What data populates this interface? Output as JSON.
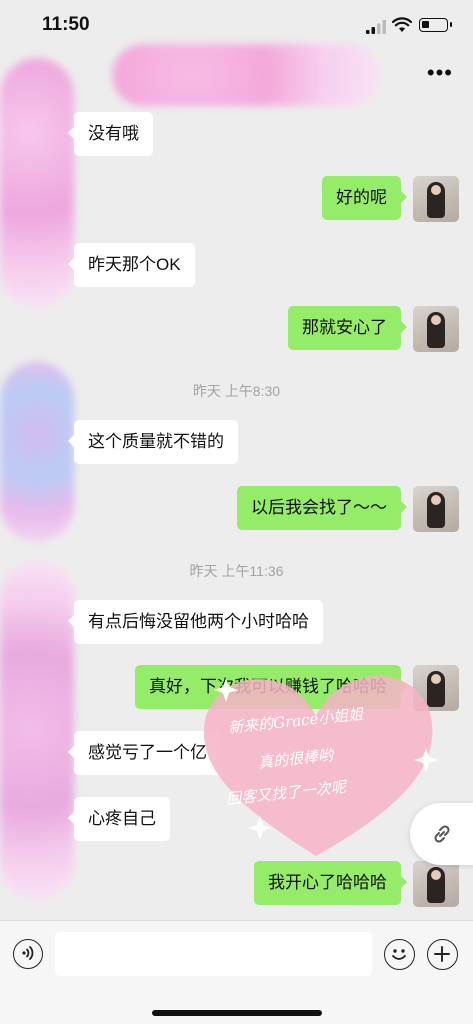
{
  "status_bar": {
    "time": "11:50"
  },
  "nav": {
    "more_icon": "more-dots-icon"
  },
  "messages": [
    {
      "side": "in",
      "text": "没有哦"
    },
    {
      "side": "out",
      "text": "好的呢"
    },
    {
      "side": "in",
      "text": "昨天那个OK"
    },
    {
      "side": "out",
      "text": "那就安心了"
    },
    {
      "type": "time",
      "text": "昨天 上午8:30"
    },
    {
      "side": "in",
      "text": "这个质量就不错的"
    },
    {
      "side": "out",
      "text": "以后我会找了～～"
    },
    {
      "type": "time",
      "text": "昨天 上午11:36"
    },
    {
      "side": "in",
      "text": "有点后悔没留他两个小时哈哈"
    },
    {
      "side": "out",
      "text": "真好，下次我可以赚钱了哈哈哈"
    },
    {
      "side": "in",
      "text": "感觉亏了一个亿"
    },
    {
      "side": "in",
      "text": "心疼自己"
    },
    {
      "side": "out",
      "text": "我开心了哈哈哈"
    }
  ],
  "sticker": {
    "line1": "新来的Grace小姐姐",
    "line2": "真的很棒哟",
    "line3": "回客又找了一次呢",
    "color": "#f6b3c6"
  },
  "input_bar": {
    "voice_icon": "voice-icon",
    "emoji_icon": "emoji-icon",
    "plus_icon": "plus-icon"
  },
  "colors": {
    "outgoing_bubble": "#95ec69",
    "incoming_bubble": "#ffffff",
    "background": "#ededed"
  }
}
